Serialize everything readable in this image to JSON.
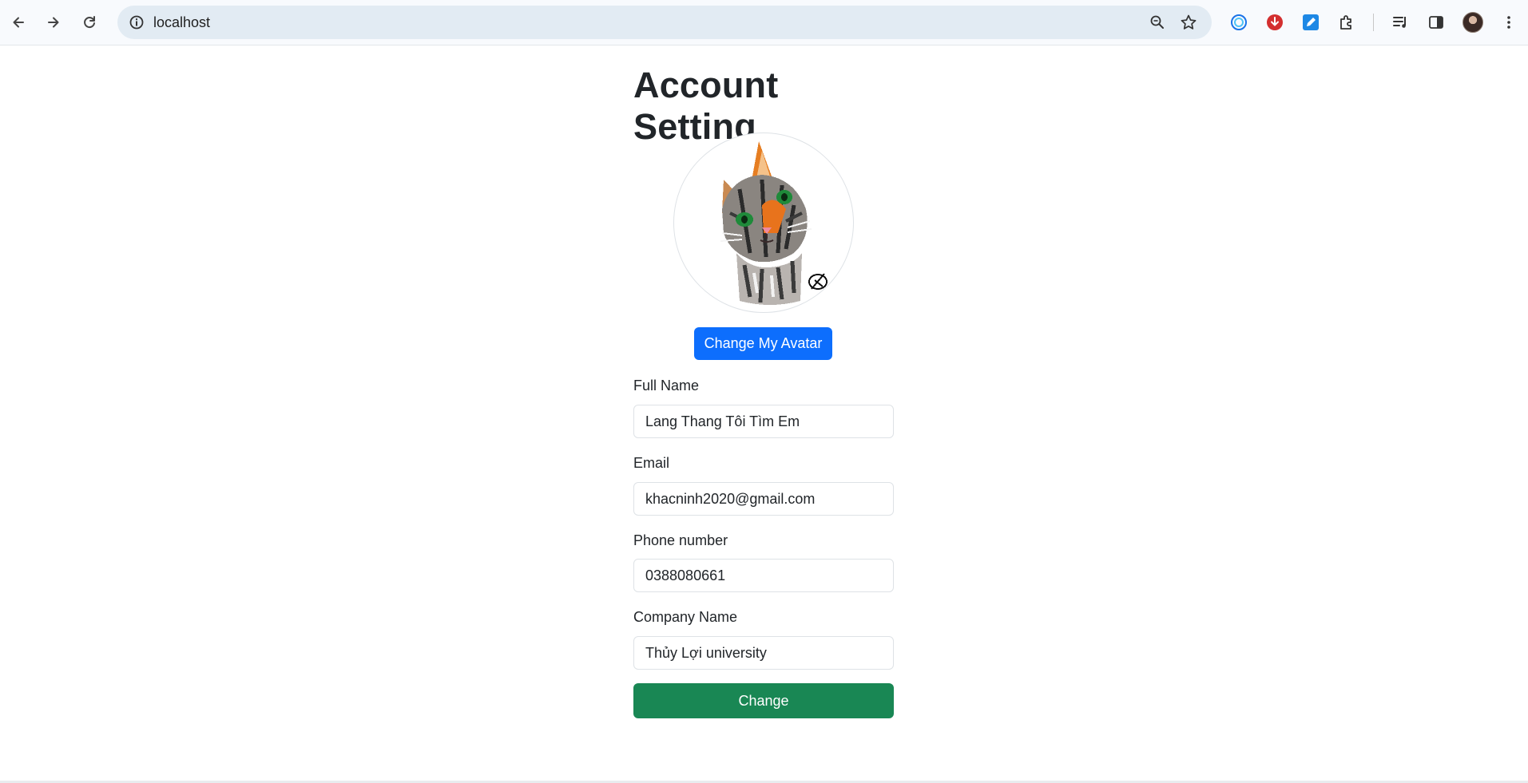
{
  "browser": {
    "url": "localhost"
  },
  "page": {
    "title": "Account Setting",
    "avatar_button": "Change My Avatar",
    "fields": [
      {
        "label": "Full Name",
        "value": "Lang Thang Tôi Tìm Em"
      },
      {
        "label": "Email",
        "value": "khacninh2020@gmail.com"
      },
      {
        "label": "Phone number",
        "value": "0388080661"
      },
      {
        "label": "Company Name",
        "value": "Thủy Lợi university"
      }
    ],
    "submit_button": "Change"
  },
  "colors": {
    "primary": "#0d6efd",
    "success": "#198754"
  }
}
